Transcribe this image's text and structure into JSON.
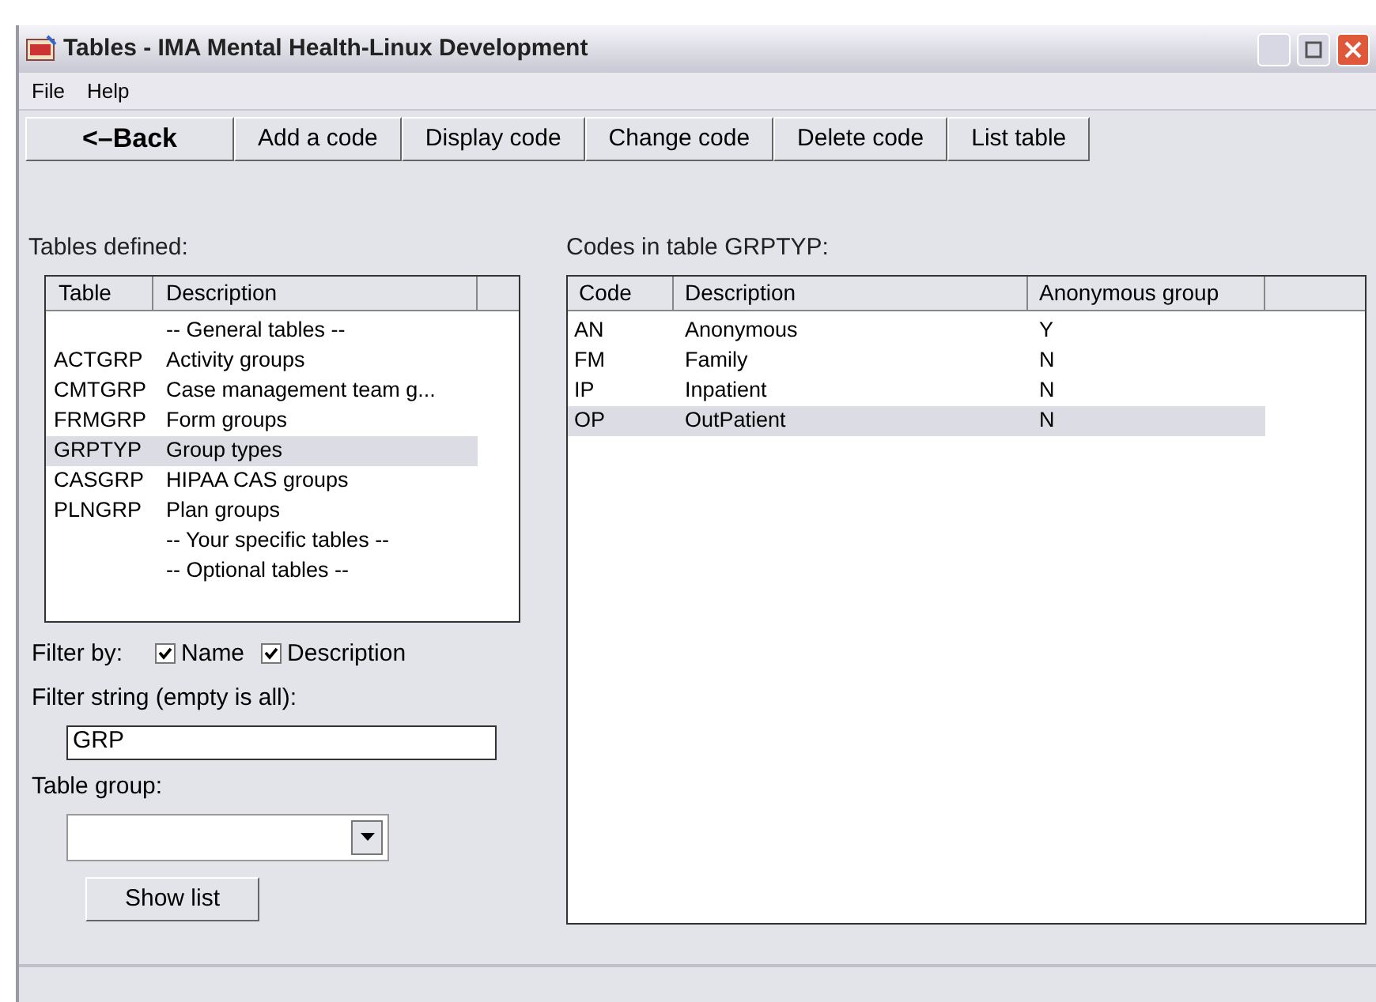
{
  "window": {
    "title": "Tables - IMA Mental Health-Linux Development"
  },
  "menu": [
    "File",
    "Help"
  ],
  "toolbar": [
    {
      "label": "<–Back",
      "kind": "back"
    },
    {
      "label": "Add a code",
      "kind": "action"
    },
    {
      "label": "Display code",
      "kind": "action"
    },
    {
      "label": "Change code",
      "kind": "action"
    },
    {
      "label": "Delete code",
      "kind": "action"
    },
    {
      "label": "List table",
      "kind": "action"
    }
  ],
  "tables_panel": {
    "label": "Tables defined:",
    "columns": [
      "Table",
      "Description"
    ],
    "rows": [
      {
        "description": "-- General tables --",
        "selected": false
      },
      {
        "table": "ACTGRP",
        "description": "Activity groups",
        "selected": false
      },
      {
        "table": "CMTGRP",
        "description": "Case management team g...",
        "selected": false
      },
      {
        "table": "FRMGRP",
        "description": "Form groups",
        "selected": false
      },
      {
        "table": "GRPTYP",
        "description": "Group types",
        "selected": true
      },
      {
        "table": "CASGRP",
        "description": "HIPAA CAS groups",
        "selected": false
      },
      {
        "table": "PLNGRP",
        "description": "Plan groups",
        "selected": false
      },
      {
        "description": "-- Your specific tables --",
        "selected": false
      },
      {
        "description": "-- Optional tables --",
        "selected": false
      }
    ]
  },
  "filter": {
    "label": "Filter by:",
    "options": [
      {
        "label": "Name",
        "checked": true
      },
      {
        "label": "Description",
        "checked": true
      }
    ],
    "string_label": "Filter string (empty is all):",
    "string_value": "GRP",
    "group_label": "Table group:",
    "button": "Show list"
  },
  "codes_panel": {
    "label": "Codes in table GRPTYP:",
    "columns": [
      "Code",
      "Description",
      "Anonymous group"
    ],
    "rows": [
      {
        "code": "AN",
        "description": "Anonymous",
        "anonymous": "Y",
        "selected": false
      },
      {
        "code": "FM",
        "description": "Family",
        "anonymous": "N",
        "selected": false
      },
      {
        "code": "IP",
        "description": "Inpatient",
        "anonymous": "N",
        "selected": false
      },
      {
        "code": "OP",
        "description": "OutPatient",
        "anonymous": "N",
        "selected": true
      }
    ]
  }
}
